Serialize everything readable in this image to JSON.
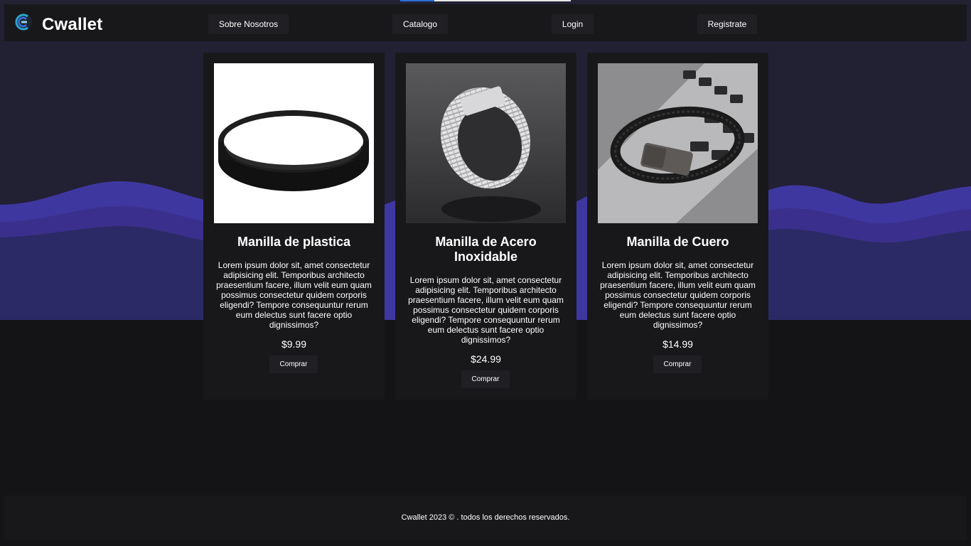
{
  "header": {
    "brand": "Cwallet",
    "nav": {
      "about": "Sobre Nosotros",
      "catalog": "Catalogo",
      "login": "Login",
      "register": "Registrate"
    }
  },
  "products": [
    {
      "title": "Manilla de plastica",
      "description": "Lorem ipsum dolor sit, amet consectetur adipisicing elit. Temporibus architecto praesentium facere, illum velit eum quam possimus consectetur quidem corporis eligendi? Tempore consequuntur rerum eum delectus sunt facere optio dignissimos?",
      "price": "$9.99",
      "buy_label": "Comprar"
    },
    {
      "title": "Manilla de Acero Inoxidable",
      "description": "Lorem ipsum dolor sit, amet consectetur adipisicing elit. Temporibus architecto praesentium facere, illum velit eum quam possimus consectetur quidem corporis eligendi? Tempore consequuntur rerum eum delectus sunt facere optio dignissimos?",
      "price": "$24.99",
      "buy_label": "Comprar"
    },
    {
      "title": "Manilla de Cuero",
      "description": "Lorem ipsum dolor sit, amet consectetur adipisicing elit. Temporibus architecto praesentium facere, illum velit eum quam possimus consectetur quidem corporis eligendi? Tempore consequuntur rerum eum delectus sunt facere optio dignissimos?",
      "price": "$14.99",
      "buy_label": "Comprar"
    }
  ],
  "footer": {
    "copyright": "Cwallet 2023 © . todos los derechos reservados."
  },
  "colors": {
    "background": "#141417",
    "panel": "#18181b",
    "button": "#202024",
    "wave_light": "#3f37a0",
    "wave_mid": "#3a2f8c",
    "wave_dark": "#2c2a66"
  }
}
